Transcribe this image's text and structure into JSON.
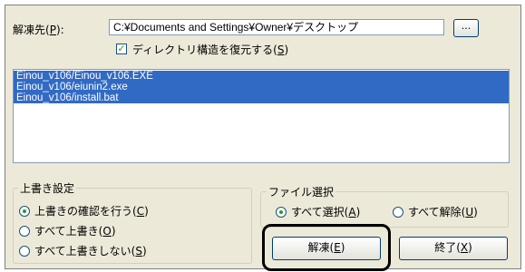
{
  "extract_to": {
    "label_prefix": "解凍先(",
    "label_key": "P",
    "label_suffix": "):",
    "path_value": "C:¥Documents and Settings¥Owner¥デスクトップ",
    "browse_label": "..."
  },
  "restore_dirs": {
    "checked": true,
    "check_glyph": "✓",
    "label_prefix": "ディレクトリ構造を復元する(",
    "label_key": "S",
    "label_suffix": ")"
  },
  "files": [
    "Einou_v106/Einou_v106.EXE",
    "Einou_v106/eiunin2.exe",
    "Einou_v106/install.bat"
  ],
  "overwrite": {
    "title": "上書き設定",
    "options": [
      {
        "text": "上書きの確認を行う(",
        "key": "C",
        "suffix": ")",
        "selected": true
      },
      {
        "text": "すべて上書き(",
        "key": "O",
        "suffix": ")",
        "selected": false
      },
      {
        "text": "すべて上書きしない(",
        "key": "S",
        "suffix": ")",
        "selected": false
      }
    ]
  },
  "file_select": {
    "title": "ファイル選択",
    "options": [
      {
        "text": "すべて選択(",
        "key": "A",
        "suffix": ")",
        "selected": true
      },
      {
        "text": "すべて解除(",
        "key": "U",
        "suffix": ")",
        "selected": false
      }
    ]
  },
  "buttons": {
    "extract": {
      "text": "解凍(",
      "key": "E",
      "suffix": ")"
    },
    "exit": {
      "text": "終了(",
      "key": "X",
      "suffix": ")"
    }
  }
}
